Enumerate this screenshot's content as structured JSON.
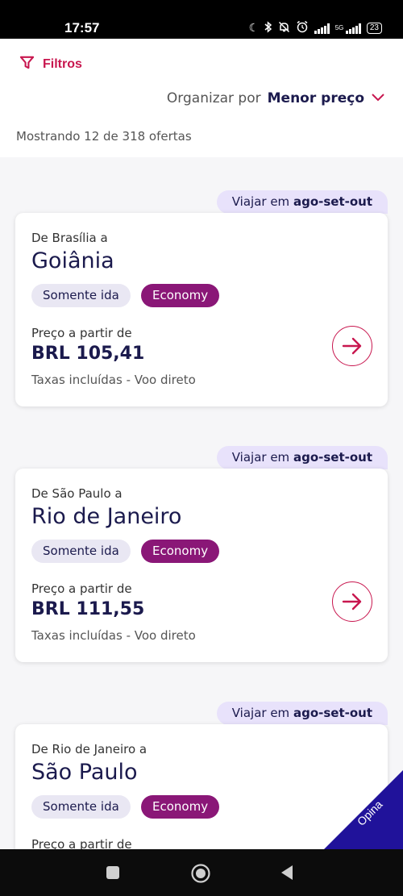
{
  "status_bar": {
    "time": "17:57",
    "network": "5G",
    "battery": "23",
    "icons": [
      "moon-icon",
      "bluetooth-icon",
      "bell-off-icon",
      "alarm-icon",
      "signal-icon",
      "signal-5g-icon",
      "battery-icon"
    ]
  },
  "header": {
    "filters_label": "Filtros",
    "sort_prefix": "Organizar por",
    "sort_value": "Menor preço",
    "showing_text": "Mostrando 12 de 318 ofertas"
  },
  "offers": [
    {
      "season_prefix": "Viajar em",
      "season_value": "ago-set-out",
      "origin": "De Brasília a",
      "destination": "Goiânia",
      "trip_type": "Somente ida",
      "cabin": "Economy",
      "price_label": "Preço a partir de",
      "price": "BRL 105,41",
      "details": "Taxas incluídas - Voo direto"
    },
    {
      "season_prefix": "Viajar em",
      "season_value": "ago-set-out",
      "origin": "De São Paulo a",
      "destination": "Rio de Janeiro",
      "trip_type": "Somente ida",
      "cabin": "Economy",
      "price_label": "Preço a partir de",
      "price": "BRL 111,55",
      "details": "Taxas incluídas - Voo direto"
    },
    {
      "season_prefix": "Viajar em",
      "season_value": "ago-set-out",
      "origin": "De Rio de Janeiro a",
      "destination": "São Paulo",
      "trip_type": "Somente ida",
      "cabin": "Economy",
      "price_label": "Preço a partir de"
    }
  ],
  "feedback": {
    "label": "Opina"
  },
  "colors": {
    "accent": "#c8174f",
    "navy": "#1b1a4d",
    "cabin_chip": "#8a1777",
    "season_tag": "#e8e2fb",
    "feedback": "#20129a"
  }
}
